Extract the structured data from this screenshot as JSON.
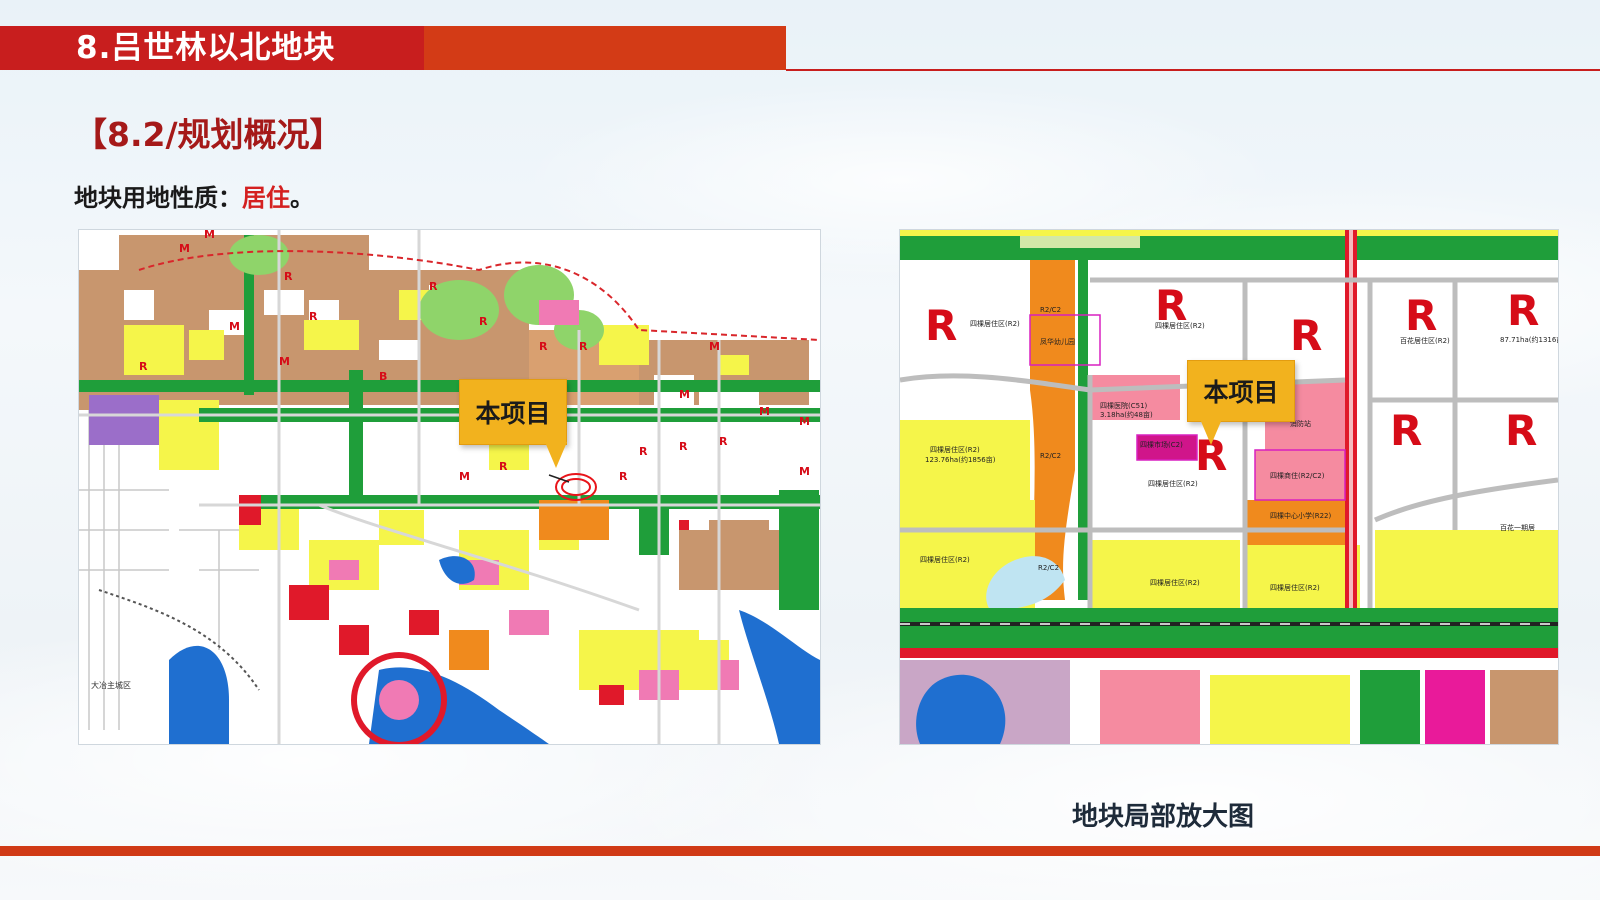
{
  "header": {
    "page_title": "8.吕世林以北地块",
    "section_title": "【8.2/规划概况】",
    "land_use_label": "地块用地性质：",
    "land_use_value": "居住",
    "land_use_suffix": "。"
  },
  "overview_map": {
    "callout": "本项目",
    "zone_letters": [
      "R",
      "M",
      "B"
    ],
    "district_label": "大冶主城区"
  },
  "detail_map": {
    "callout": "本项目",
    "zone_letter": "R",
    "labels": {
      "kindergarten": "凤华幼儿园",
      "r2c2_1": "R2/C2",
      "r2c2_2": "R2/C2",
      "r2c2_3": "R2/C2",
      "residential_1": "四棵居住区(R2)",
      "residential_2": "四棵居住区(R2)",
      "residential_3": "四棵居住区(R2)",
      "residential_4": "四棵居住区(R2)",
      "residential_5": "四棵居住区(R2)",
      "residential_6": "四棵居住区(R2)",
      "residential_area": "123.76ha(约1856亩)",
      "hospital": "四棵医院(C51)",
      "hospital_area": "3.18ha(约48亩)",
      "market": "四棵市场(C2)",
      "fire_station": "消防站",
      "commerce": "四棵商住(R2/C2)",
      "school": "四棵中心小学(R22)",
      "baihua_1": "百花居住区(R2)",
      "baihua_area": "87.71ha(约1316亩)",
      "baihua_2": "百花一期居"
    }
  },
  "caption": "地块局部放大图",
  "colors": {
    "title_red": "#c81e1e",
    "accent_orange": "#d33b16",
    "callout_gold": "#f2b21e",
    "highlight_red": "#d42020",
    "residential_yellow": "#f5f54a",
    "industrial_brown": "#c8966e",
    "green_space": "#1f9e3a",
    "water_blue": "#1f6fd0"
  }
}
